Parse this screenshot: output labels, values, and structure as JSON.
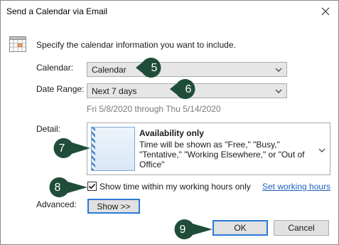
{
  "window": {
    "title": "Send a Calendar via Email"
  },
  "intro": "Specify the calendar information you want to include.",
  "calendar": {
    "label": "Calendar:",
    "value": "Calendar"
  },
  "date_range": {
    "label": "Date Range:",
    "value": "Next 7 days",
    "summary": "Fri 5/8/2020 through Thu 5/14/2020"
  },
  "detail": {
    "label": "Detail:",
    "heading": "Availability only",
    "description": "Time will be shown as \"Free,\" \"Busy,\" \"Tentative,\" \"Working Elsewhere,\" or \"Out of Office\""
  },
  "working_hours": {
    "checkbox_label": "Show time within my working hours only",
    "checked": true,
    "link": "Set working hours"
  },
  "advanced": {
    "label": "Advanced:",
    "button": "Show >>"
  },
  "buttons": {
    "ok": "OK",
    "cancel": "Cancel"
  },
  "callouts": [
    "5",
    "6",
    "7",
    "8",
    "9"
  ],
  "colors": {
    "callout_fill": "#1f4d3a",
    "callout_text": "#ffffff",
    "link": "#1f5fbf",
    "summary_text": "#7a7a7a"
  }
}
